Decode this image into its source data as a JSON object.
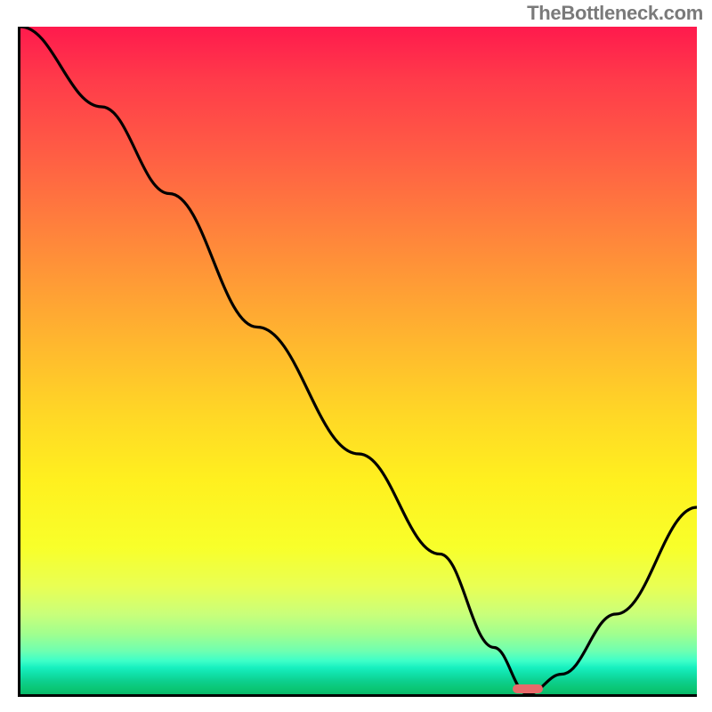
{
  "watermark": "TheBottleneck.com",
  "chart_data": {
    "type": "line",
    "title": "",
    "xlabel": "",
    "ylabel": "",
    "x_range": [
      0,
      100
    ],
    "y_range": [
      0,
      100
    ],
    "optimal_x": 75,
    "series": [
      {
        "name": "bottleneck-curve",
        "x": [
          0,
          12,
          22,
          35,
          50,
          62,
          70,
          75,
          80,
          88,
          100
        ],
        "values": [
          100,
          88,
          75,
          55,
          36,
          21,
          7,
          0,
          3,
          12,
          28
        ]
      }
    ],
    "background_gradient": {
      "top": "#ff1a4d",
      "mid": "#fff01f",
      "bottom": "#08b868"
    },
    "marker_color": "#e86a6a"
  }
}
